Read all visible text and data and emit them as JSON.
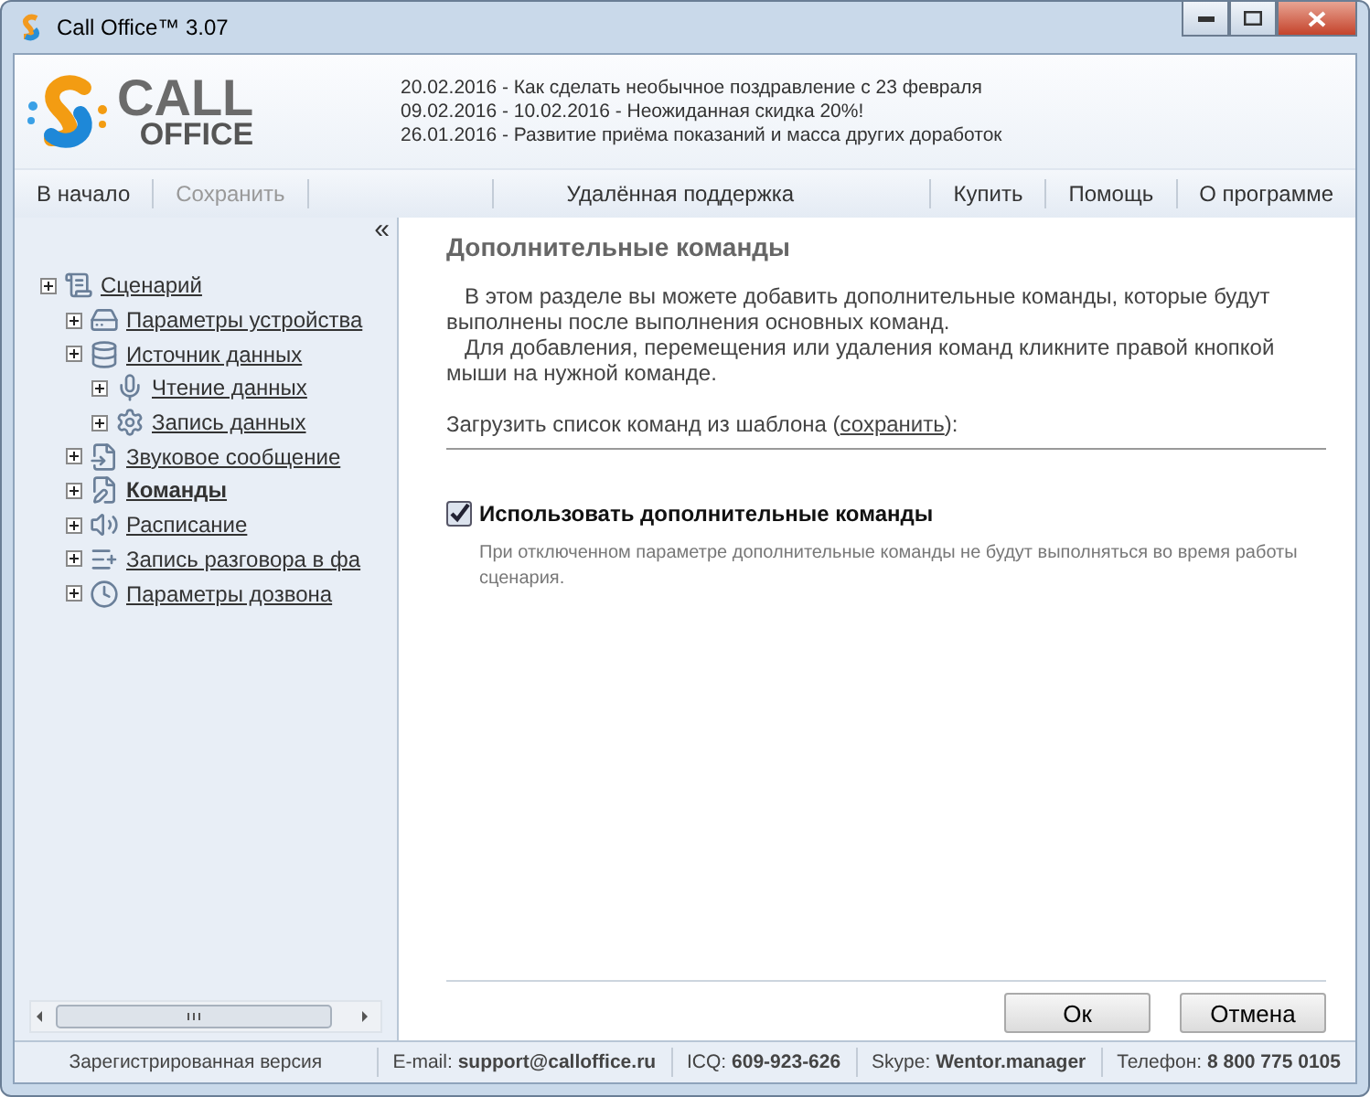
{
  "window": {
    "title": "Call Office™ 3.07"
  },
  "logo": {
    "line1": "CALL",
    "line2": "OFFICE"
  },
  "news": [
    "20.02.2016 - Как сделать необычное поздравление с 23 февраля",
    "09.02.2016 - 10.02.2016 - Неожиданная скидка 20%!",
    "26.01.2016 - Развитие приёма показаний и масса других доработок"
  ],
  "toolbar": {
    "left": [
      {
        "label": "В начало",
        "disabled": false
      },
      {
        "label": "Сохранить",
        "disabled": true
      }
    ],
    "center": [
      {
        "label": "Удалённая поддержка",
        "disabled": false
      }
    ],
    "right": [
      {
        "label": "Купить",
        "disabled": false
      },
      {
        "label": "Помощь",
        "disabled": false
      },
      {
        "label": "О программе",
        "disabled": false
      }
    ]
  },
  "sidebar": {
    "collapse": "«",
    "tree": [
      {
        "label": "Сценарий",
        "selected": false,
        "children": [
          {
            "label": "Параметры устройства",
            "selected": false
          },
          {
            "label": "Источник данных",
            "selected": false,
            "children": [
              {
                "label": "Чтение данных",
                "selected": false
              },
              {
                "label": "Запись данных",
                "selected": false
              }
            ]
          },
          {
            "label": "Звуковое сообщение",
            "selected": false
          },
          {
            "label": "Команды",
            "selected": true
          },
          {
            "label": "Расписание",
            "selected": false
          },
          {
            "label": "Запись разговора в фа",
            "selected": false
          },
          {
            "label": "Параметры дозвона",
            "selected": false
          }
        ]
      }
    ]
  },
  "content": {
    "title": "Дополнительные команды",
    "paragraphs": [
      "В этом разделе вы можете добавить дополнительные команды, которые будут выполнены после выполнения основных команд.",
      "Для добавления, перемещения или удаления команд кликните правой кнопкой мыши на нужной команде."
    ],
    "template": {
      "before": "Загрузить список команд из шаблона (",
      "link": "сохранить",
      "after": "):"
    },
    "option": {
      "label": "Использовать дополнительные команды",
      "checked": true,
      "hint": "При отключенном параметре дополнительные команды не будут выполняться во время работы сценария."
    }
  },
  "buttons": [
    "Ок",
    "Отмена"
  ],
  "status_bar": [
    "Зарегистрированная версия",
    "E-mail: **support@calloffice.ru**",
    "ICQ: **609-923-626**",
    "Skype: **Wentor.manager**",
    "Телефон: **8 800 775 0105**"
  ]
}
